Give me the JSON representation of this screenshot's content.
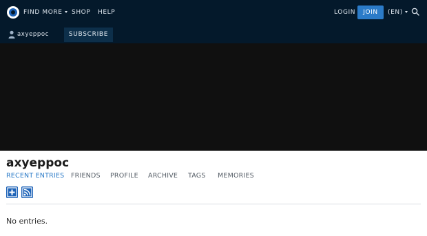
{
  "header": {
    "nav": [
      {
        "label": "FIND MORE",
        "has_dropdown": true
      },
      {
        "label": "SHOP"
      },
      {
        "label": "HELP"
      }
    ],
    "login_label": "LOGIN",
    "join_label": "JOIN",
    "language_label": "(EN)",
    "search_icon": "search-icon",
    "logo_icon": "site-logo-icon"
  },
  "subbar": {
    "username": "axyeppoc",
    "user_icon": "user-icon",
    "subscribe_label": "SUBSCRIBE"
  },
  "journal": {
    "title": "axyeppoc",
    "tabs": [
      {
        "label": "RECENT ENTRIES",
        "active": true
      },
      {
        "label": "FRIENDS"
      },
      {
        "label": "PROFILE"
      },
      {
        "label": "ARCHIVE"
      },
      {
        "label": "TAGS"
      },
      {
        "label": "MEMORIES"
      }
    ],
    "tools": [
      {
        "icon": "add-entry-icon"
      },
      {
        "icon": "rss-icon"
      }
    ],
    "empty_message": "No entries."
  },
  "colors": {
    "header_bg": "#04192b",
    "accent": "#2b7bc8",
    "banner_bg": "#101010"
  }
}
